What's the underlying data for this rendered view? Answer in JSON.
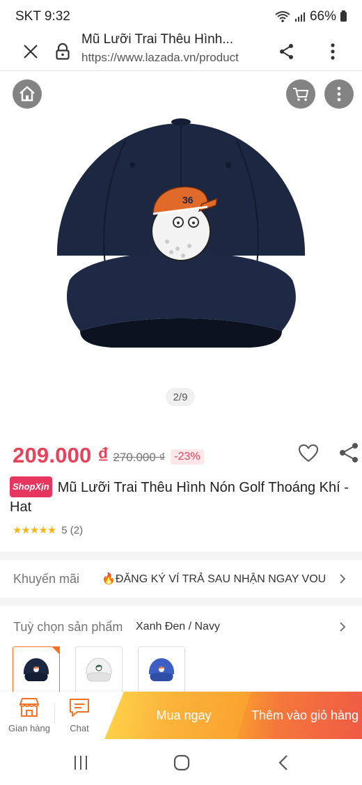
{
  "status_bar": {
    "carrier_time": "SKT 9:32",
    "battery": "66%"
  },
  "browser": {
    "title": "Mũ Lưỡi Trai Thêu Hình...",
    "url": "https://www.lazada.vn/product"
  },
  "gallery": {
    "counter": "2/9"
  },
  "product": {
    "price": "209.000 ₫",
    "original_price": "270.000 ₫",
    "discount": "-23%",
    "badge": "ShopXịn",
    "title": "Mũ Lưỡi Trai Thêu Hình Nón Golf Thoáng Khí - Hat",
    "rating_stars": "★★★★★",
    "rating_text": "5 (2)"
  },
  "promo": {
    "label": "Khuyến mãi",
    "value": "🔥ĐĂNG KÝ VÍ TRẢ SAU NHẬN NGAY VOU..."
  },
  "options": {
    "label": "Tuỳ chọn sản phẩm",
    "value": "Xanh Đen / Navy",
    "variants": [
      "navy",
      "white",
      "blue"
    ]
  },
  "action_bar": {
    "store_label": "Gian hàng",
    "chat_label": "Chat",
    "buy_now": "Mua ngay",
    "add_to_cart": "Thêm vào giỏ hàng"
  },
  "colors": {
    "price": "#e8425a",
    "accent": "#f57224",
    "cap_navy": "#1c2741",
    "cap_blue": "#3d5fc4"
  },
  "icons": [
    "close-icon",
    "lock-icon",
    "share-icon",
    "more-icon",
    "home-icon",
    "cart-icon",
    "heart-icon",
    "chevron-right-icon",
    "store-icon",
    "chat-icon",
    "recent-apps-icon",
    "home-nav-icon",
    "back-icon"
  ]
}
